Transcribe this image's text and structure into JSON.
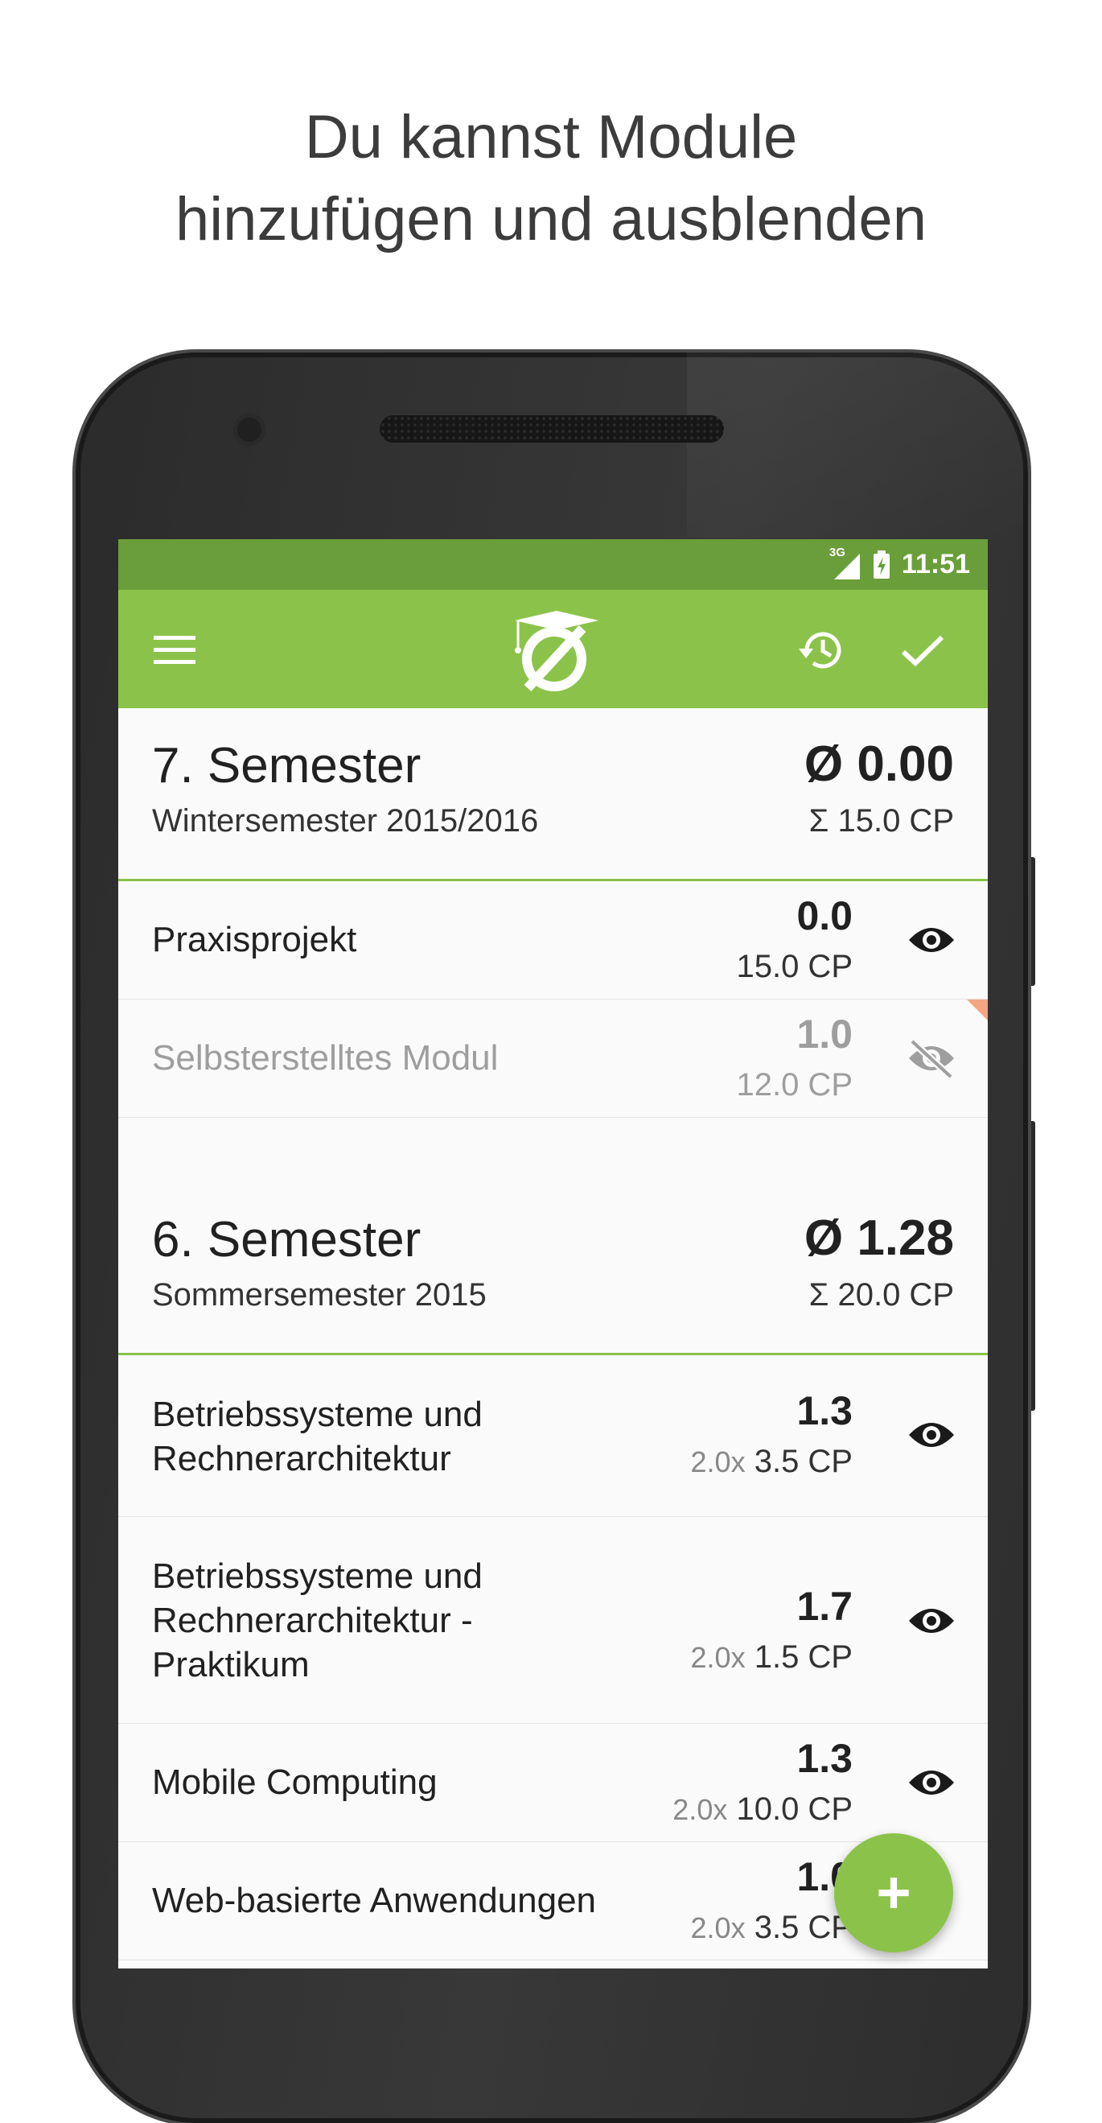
{
  "headline": {
    "line1": "Du kannst Module",
    "line2": "hinzufügen und ausblenden"
  },
  "status_bar": {
    "network": "3G",
    "time": "11:51"
  },
  "app_bar": {
    "menu_icon": "menu-icon",
    "logo_icon": "graduation-cap-average-logo",
    "history_icon": "history-icon",
    "check_icon": "check-icon",
    "color": "#8bc34a",
    "status_color": "#6a9e3a"
  },
  "semesters": [
    {
      "title": "7. Semester",
      "subtitle": "Wintersemester 2015/2016",
      "average": "Ø 0.00",
      "credits": "Σ 15.0 CP",
      "modules": [
        {
          "name": "Praxisprojekt",
          "grade": "0.0",
          "factor": "",
          "cp": "15.0 CP",
          "visible": true
        },
        {
          "name": "Selbsterstelltes Modul",
          "grade": "1.0",
          "factor": "",
          "cp": "12.0 CP",
          "visible": false
        }
      ]
    },
    {
      "title": "6. Semester",
      "subtitle": "Sommersemester 2015",
      "average": "Ø 1.28",
      "credits": "Σ 20.0 CP",
      "modules": [
        {
          "name": "Betriebssysteme und Rechnerarchitektur",
          "grade": "1.3",
          "factor": "2.0x",
          "cp": "3.5 CP",
          "visible": true
        },
        {
          "name": "Betriebssysteme und Rechnerarchitektur - Praktikum",
          "grade": "1.7",
          "factor": "2.0x",
          "cp": "1.5 CP",
          "visible": true
        },
        {
          "name": "Mobile Computing",
          "grade": "1.3",
          "factor": "2.0x",
          "cp": "10.0 CP",
          "visible": true
        },
        {
          "name": "Web-basierte Anwendungen",
          "grade": "1.0",
          "factor": "2.0x",
          "cp": "3.5 CP",
          "visible": true
        }
      ]
    }
  ],
  "fab": {
    "label": "+",
    "icon": "plus-icon"
  }
}
